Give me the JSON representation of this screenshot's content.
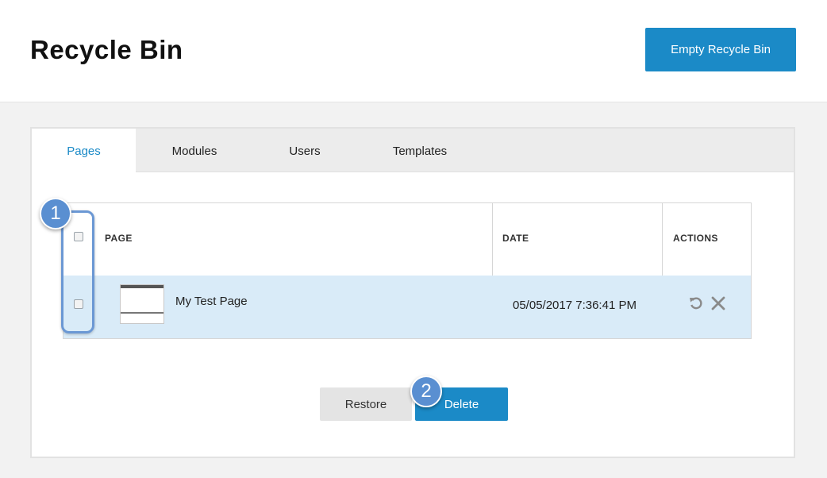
{
  "header": {
    "title": "Recycle Bin",
    "empty_button_label": "Empty Recycle Bin"
  },
  "tabs": [
    {
      "label": "Pages",
      "active": true
    },
    {
      "label": "Modules",
      "active": false
    },
    {
      "label": "Users",
      "active": false
    },
    {
      "label": "Templates",
      "active": false
    }
  ],
  "table": {
    "columns": [
      "PAGE",
      "DATE",
      "ACTIONS"
    ],
    "rows": [
      {
        "name": "My Test Page",
        "date": "05/05/2017 7:36:41 PM",
        "selected": true
      }
    ]
  },
  "actions": {
    "restore_label": "Restore",
    "delete_label": "Delete"
  },
  "callouts": [
    "1",
    "2"
  ],
  "colors": {
    "accent": "#1b8ac7",
    "row_highlight": "#d9ebf8",
    "callout": "#5a8fd1"
  },
  "icons": {
    "restore": "restore-icon",
    "delete": "close-icon"
  }
}
